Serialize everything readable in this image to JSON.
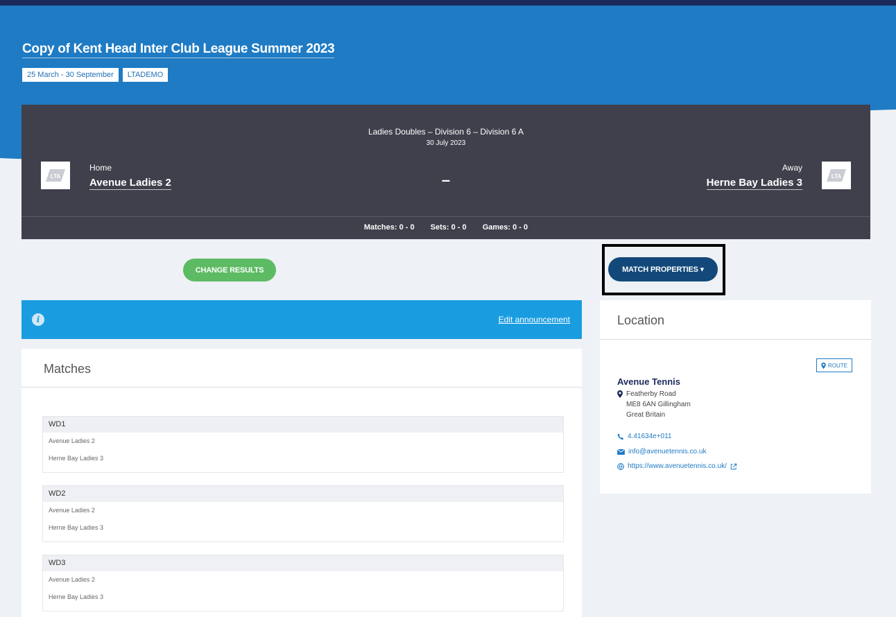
{
  "league": {
    "title": "Copy of Kent Head Inter Club League Summer 2023",
    "date_range": "25 March - 30 September",
    "code": "LTADEMO"
  },
  "match": {
    "competition": "Ladies Doubles – Division 6 – Division 6 A",
    "date": "30 July 2023",
    "home_label": "Home",
    "home_team": "Avenue Ladies 2",
    "away_label": "Away",
    "away_team": "Herne Bay Ladies 3",
    "score": "–",
    "logo_text": "LTA",
    "stats": {
      "matches": "Matches: 0 - 0",
      "sets": "Sets: 0 - 0",
      "games": "Games: 0 - 0"
    }
  },
  "actions": {
    "change_results": "CHANGE RESULTS",
    "match_properties": "MATCH PROPERTIES ▾"
  },
  "announcement": {
    "edit_link": "Edit announcement"
  },
  "matches": {
    "title": "Matches",
    "items": [
      {
        "code": "WD1",
        "home": "Avenue Ladies 2",
        "away": "Herne Bay Ladies 3"
      },
      {
        "code": "WD2",
        "home": "Avenue Ladies 2",
        "away": "Herne Bay Ladies 3"
      },
      {
        "code": "WD3",
        "home": "Avenue Ladies 2",
        "away": "Herne Bay Ladies 3"
      }
    ]
  },
  "location": {
    "title": "Location",
    "route_label": "ROUTE",
    "venue": "Avenue Tennis",
    "address_line1": "Featherby Road",
    "address_line2": "ME8 6AN Gillingham",
    "address_line3": "Great Britain",
    "phone": "4.41634e+011",
    "email": "info@avenuetennis.co.uk",
    "website": "https://www.avenuetennis.co.uk/"
  },
  "colors": {
    "hero_blue": "#1f7bc4",
    "dark_card": "#3f404c",
    "green_button": "#5dbb63",
    "navy_button": "#12497a",
    "announce_blue": "#1a9de0"
  },
  "icons": [
    "info-icon",
    "map-pin-icon",
    "phone-icon",
    "mail-icon",
    "globe-icon",
    "external-link-icon",
    "caret-down-icon"
  ]
}
